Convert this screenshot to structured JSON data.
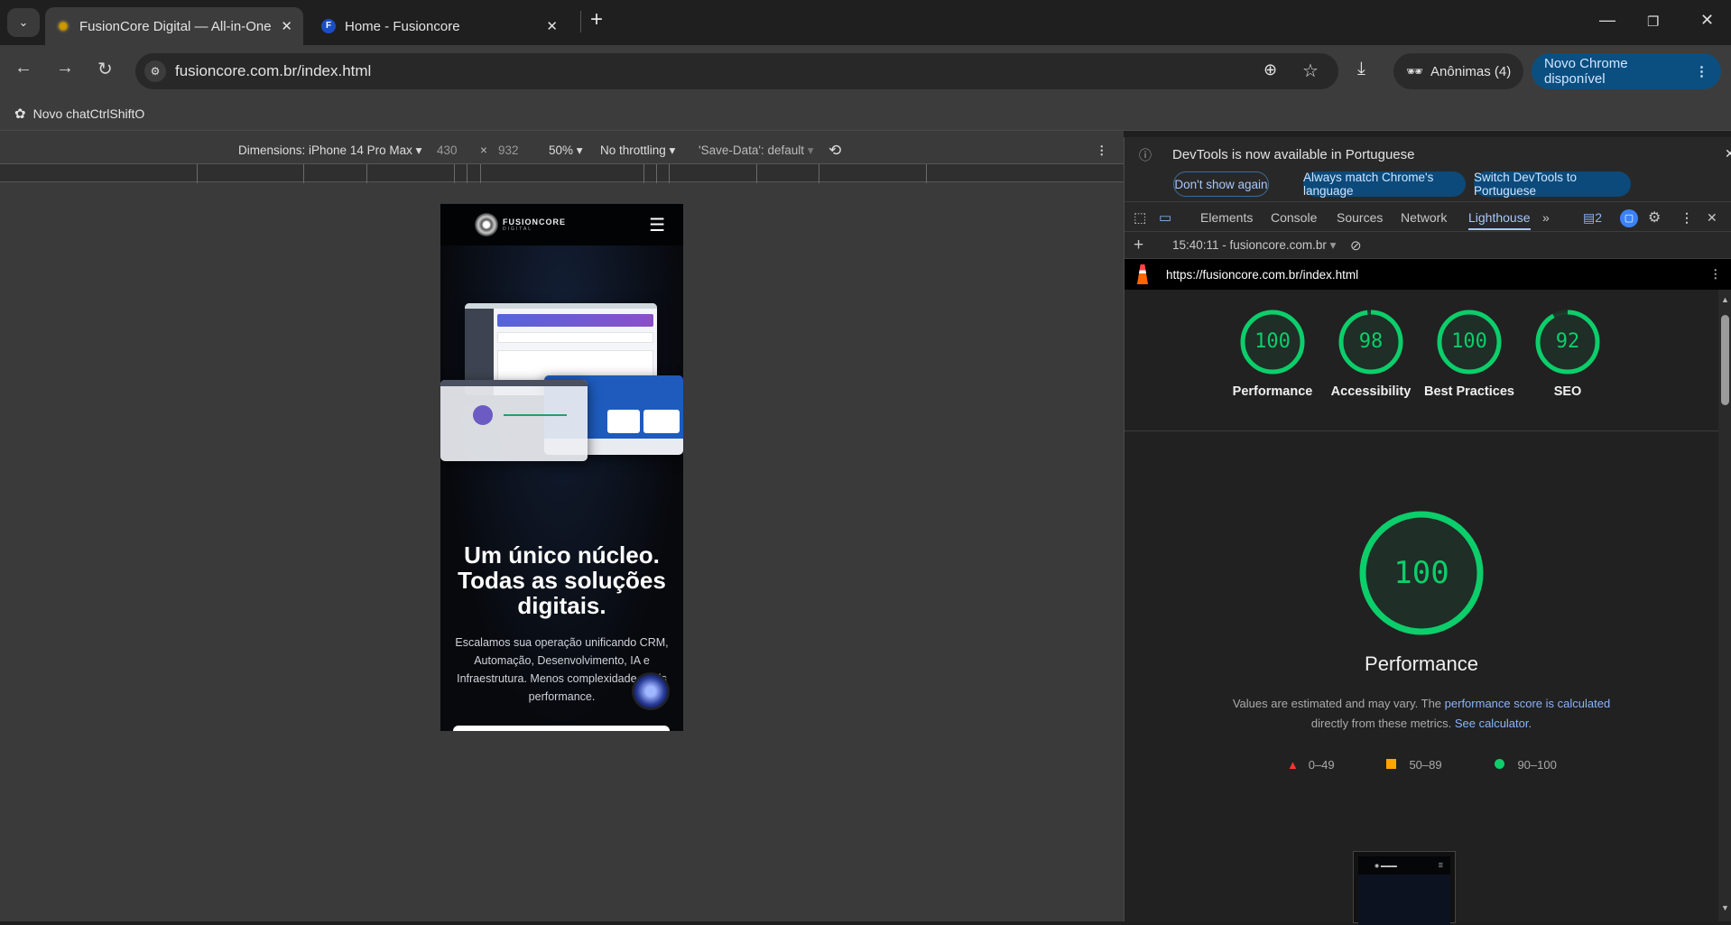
{
  "browser": {
    "tabs": [
      {
        "title": "FusionCore Digital — All-in-One",
        "active": true
      },
      {
        "title": "Home - Fusioncore",
        "active": false
      }
    ],
    "url": "fusioncore.com.br/index.html",
    "profile_label": "Anônimas (4)",
    "update_label": "Novo Chrome disponível",
    "bookmarks": [
      {
        "label": "Novo chatCtrlShiftO"
      }
    ]
  },
  "device_toolbar": {
    "dimensions_label": "Dimensions: iPhone 14 Pro Max",
    "width": "430",
    "times": "×",
    "height": "932",
    "zoom": "50%",
    "throttling": "No throttling",
    "save_data": "'Save-Data': default"
  },
  "page": {
    "logo_text": "FUSIONCORE",
    "logo_sub": "DIGITAL",
    "headline": "Um único núcleo. Todas as soluções digitais.",
    "subtext": "Escalamos sua operação unificando CRM, Automação, Desenvolvimento, IA e Infraestrutura. Menos complexidade, mais performance."
  },
  "devtools": {
    "info_message": "DevTools is now available in Portuguese",
    "info_buttons": {
      "dont_show": "Don't show again",
      "match": "Always match Chrome's language",
      "switch": "Switch DevTools to Portuguese"
    },
    "tabs": [
      "Elements",
      "Console",
      "Sources",
      "Network",
      "Lighthouse"
    ],
    "active_tab": "Lighthouse",
    "issues_count": "2",
    "report_selector": "15:40:11 - fusioncore.com.br",
    "report_url": "https://fusioncore.com.br/index.html",
    "scores": [
      {
        "label": "Performance",
        "value": 100
      },
      {
        "label": "Accessibility",
        "value": 98
      },
      {
        "label": "Best Practices",
        "value": 100
      },
      {
        "label": "SEO",
        "value": 92
      }
    ],
    "main_gauge": {
      "label": "Performance",
      "value": 100
    },
    "description_pre": "Values are estimated and may vary. The ",
    "description_link": "performance score is calculated",
    "description_mid": " directly from these metrics. ",
    "description_link2": "See calculator.",
    "legend": [
      {
        "range": "0–49",
        "shape": "triangle",
        "color": "#ff3333"
      },
      {
        "range": "50–89",
        "shape": "square",
        "color": "#ffa400"
      },
      {
        "range": "90–100",
        "shape": "circle",
        "color": "#0cce6b"
      }
    ],
    "colors": {
      "pass": "#0cce6b",
      "accent": "#8ab4f8"
    }
  }
}
